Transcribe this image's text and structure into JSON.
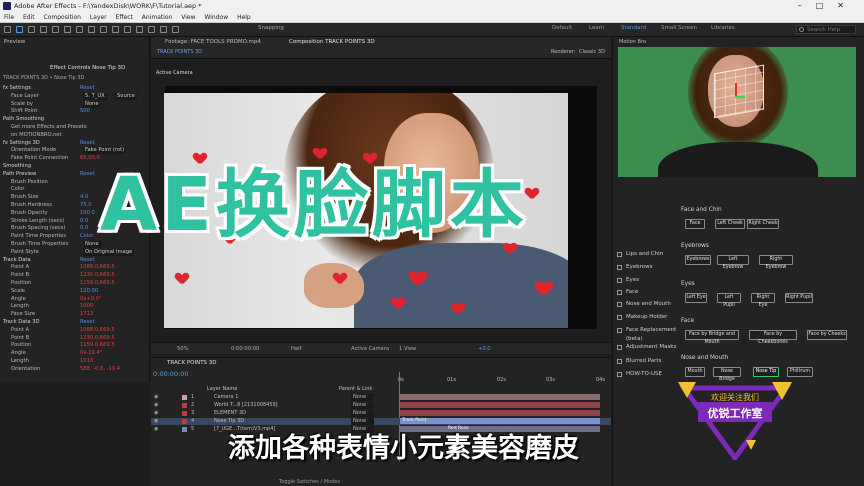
{
  "window": {
    "title": "Adobe After Effects - F:\\YandexDisk\\WORK\\F\\Tutorial.aep *"
  },
  "menu": [
    "File",
    "Edit",
    "Composition",
    "Layer",
    "Effect",
    "Animation",
    "View",
    "Window",
    "Help"
  ],
  "toolbar": {
    "snapping": "Snapping",
    "workspaces": [
      "Default",
      "Learn",
      "Standard",
      "Small Screen",
      "Libraries"
    ],
    "active_workspace": "Standard",
    "search_placeholder": "Search Help"
  },
  "left_panel": {
    "tabs": [
      "Preview",
      "Effect Controls Nose Tip 3D"
    ],
    "layer_label": "TRACK POINTS 3D • Nose Tip 3D",
    "rows": [
      {
        "label": "fx  Settings",
        "value": "Reset"
      },
      {
        "label": "Face Layer",
        "value": "5. T_UX",
        "extra": "Source"
      },
      {
        "label": "Scale by",
        "value": "None"
      },
      {
        "label": "Shift Point",
        "value": "500"
      },
      {
        "label": "Path Smoothing",
        "value": ""
      },
      {
        "label": "Get more Effects and Presets",
        "value": ""
      },
      {
        "label": "on MOTIONBRO.net",
        "value": ""
      },
      {
        "label": "fx  Settings 3D",
        "value": "Reset"
      },
      {
        "label": "Orientation Mode",
        "value": "Fake Point (rot)"
      },
      {
        "label": "Fake Point Connection",
        "value": "65,00,0"
      },
      {
        "label": "Smoothing",
        "value": ""
      },
      {
        "label": "Path Preview",
        "value": "Reset"
      },
      {
        "label": "Brush Position",
        "value": ""
      },
      {
        "label": "Color",
        "value": ""
      },
      {
        "label": "Brush Size",
        "value": "4.0"
      },
      {
        "label": "Brush Hardness",
        "value": "75.0"
      },
      {
        "label": "Brush Opacity",
        "value": "100.0"
      },
      {
        "label": "Stroke Length (secs)",
        "value": "0.0"
      },
      {
        "label": "Brush Spacing (secs)",
        "value": "0.0"
      },
      {
        "label": "Paint Time Properties",
        "value": "Color"
      },
      {
        "label": "Brush Time Properties",
        "value": "None"
      },
      {
        "label": "Paint Style",
        "value": "On Original Image"
      },
      {
        "label": "Track Data",
        "value": "Reset"
      },
      {
        "label": "Point A",
        "value": "1088.0,669.5"
      },
      {
        "label": "Point B",
        "value": "1230.0,669.5"
      },
      {
        "label": "Position",
        "value": "1159.0,669.5"
      },
      {
        "label": "Scale",
        "value": "120.00"
      },
      {
        "label": "Angle",
        "value": "0x+0.0°"
      },
      {
        "label": "Length",
        "value": "1000"
      },
      {
        "label": "Face Size",
        "value": "1713"
      },
      {
        "label": "Track Data 3D",
        "value": "Reset"
      },
      {
        "label": "Point A",
        "value": "1088.0,669.5"
      },
      {
        "label": "Point B",
        "value": "1230.0,669.5"
      },
      {
        "label": "Position",
        "value": "1159.0,669.5"
      },
      {
        "label": "Angle",
        "value": "0x-19.4°"
      },
      {
        "label": "Length",
        "value": "1010"
      },
      {
        "label": "Orientation",
        "value": "588, -0.6, -19.4"
      }
    ]
  },
  "comp_panel": {
    "footage_tab": "Footage: FACE TOOLS PROMO.mp4",
    "comp_tab": "Composition TRACK POINTS 3D",
    "sub_tab": "TRACK POINTS 3D",
    "renderer": "Renderer:",
    "renderer_value": "Classic 3D",
    "camera_label": "Active Camera",
    "zoom": "50%",
    "timecode": "0:00:00:00",
    "quality": "Half",
    "view": "Active Camera",
    "views": "1 View",
    "exposure": "+0.0"
  },
  "timeline": {
    "tab": "TRACK POINTS 3D",
    "timecode": "0:00:00:00",
    "columns": {
      "layer_name": "Layer Name",
      "parent": "Parent & Link"
    },
    "ruler": [
      "0s",
      "01s",
      "02s",
      "03s",
      "04s"
    ],
    "layers": [
      {
        "num": "1",
        "name": "Camera 1",
        "parent": "None",
        "color": "#c7a6a6"
      },
      {
        "num": "2",
        "name": "World T...8 [2131008459]",
        "parent": "None",
        "color": "#c23a3a"
      },
      {
        "num": "3",
        "name": "ELEMENT 3D",
        "parent": "None",
        "color": "#c23a3a"
      },
      {
        "num": "4",
        "name": "Nose Tip 3D",
        "parent": "None",
        "color": "#c23a3a"
      },
      {
        "num": "5",
        "name": "[7_UGE...T(tem)V3.mp4]",
        "parent": "None",
        "color": "#6d8fb8"
      }
    ],
    "bar_labels": [
      "Track Point",
      "Red Rose"
    ],
    "footer": "Toggle Switches / Modes"
  },
  "right_panel": {
    "title": "Motion Bro",
    "sections": [
      {
        "name": "Face and Chin",
        "buttons": [
          "Face",
          "Left Cheek",
          "Right Cheek"
        ]
      },
      {
        "name": "Eyebrows",
        "buttons": [
          "Eyebrows",
          "Left Eyebrow",
          "Right Eyebrow"
        ]
      },
      {
        "name": "Eyes",
        "buttons": [
          "Left Eye",
          "Left Pupil",
          "Right Eye",
          "Right Pupil"
        ]
      },
      {
        "name": "Face",
        "buttons": [
          "Face by Bridge and Mouth",
          "Face by Cheekbones",
          "Face by Cheeks"
        ]
      },
      {
        "name": "Nose and Mouth",
        "buttons": [
          "Mouth",
          "Nose Bridge",
          "Nose Tip",
          "Philtrum"
        ]
      }
    ],
    "sidebar": [
      "Lips and Chin",
      "Eyebrows",
      "Eyes",
      "Face",
      "Nose and Mouth",
      "Makeup Holder",
      "Face Replacement (beta)",
      "Adjustment Masks",
      "Blurred Parts",
      "HOW-TO-USE"
    ]
  },
  "overlay": {
    "headline": "AE换脸脚本",
    "subtitle": "添加各种表情小元素美容磨皮",
    "logo_top": "欢迎关注我们",
    "logo_name": "优锐工作室"
  },
  "colors": {
    "accent_blue": "#4f8fe0",
    "value_red": "#e04040",
    "headline_teal": "#2fc1a0",
    "logo_purple": "#7b2bb8",
    "logo_yellow": "#f2c12e"
  }
}
